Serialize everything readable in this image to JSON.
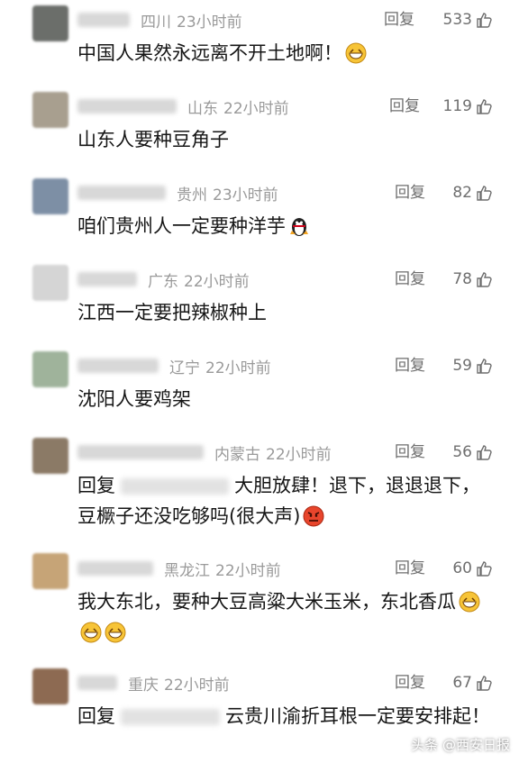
{
  "actions": {
    "reply_label": "回复"
  },
  "comments": [
    {
      "location": "四川",
      "time": "23小时前",
      "likes": "533",
      "text": "中国人果然永远离不开土地啊！",
      "emoji": [
        "grin"
      ],
      "avatar_color": "#6b6e6a"
    },
    {
      "location": "山东",
      "time": "22小时前",
      "likes": "119",
      "text": "山东人要种豆角子",
      "emoji": [],
      "avatar_color": "#a89f8f"
    },
    {
      "location": "贵州",
      "time": "23小时前",
      "likes": "82",
      "text": "咱们贵州人一定要种洋芋",
      "emoji": [
        "penguin"
      ],
      "avatar_color": "#7d8fa5"
    },
    {
      "location": "广东",
      "time": "22小时前",
      "likes": "78",
      "text": "江西一定要把辣椒种上",
      "emoji": [],
      "avatar_color": "#d5d5d5"
    },
    {
      "location": "辽宁",
      "time": "22小时前",
      "likes": "59",
      "text": "沈阳人要鸡架",
      "emoji": [],
      "avatar_color": "#9fb39b"
    },
    {
      "location": "内蒙古",
      "time": "22小时前",
      "likes": "56",
      "text_prefix": "回复",
      "text": "大胆放肆！退下，退退退下，豆橛子还没吃够吗(很大声)",
      "emoji": [
        "angry"
      ],
      "avatar_color": "#8b7a66"
    },
    {
      "location": "黑龙江",
      "time": "22小时前",
      "likes": "60",
      "text": "我大东北，要种大豆高粱大米玉米，东北香瓜",
      "emoji": [
        "grin",
        "grin",
        "grin"
      ],
      "avatar_color": "#c6a477"
    },
    {
      "location": "重庆",
      "time": "22小时前",
      "likes": "67",
      "text_prefix": "回复",
      "text": "云贵川渝折耳根一定要安排起！",
      "emoji": [],
      "avatar_color": "#8d6a52"
    }
  ],
  "watermark": {
    "text": "头条 @西安日报"
  }
}
